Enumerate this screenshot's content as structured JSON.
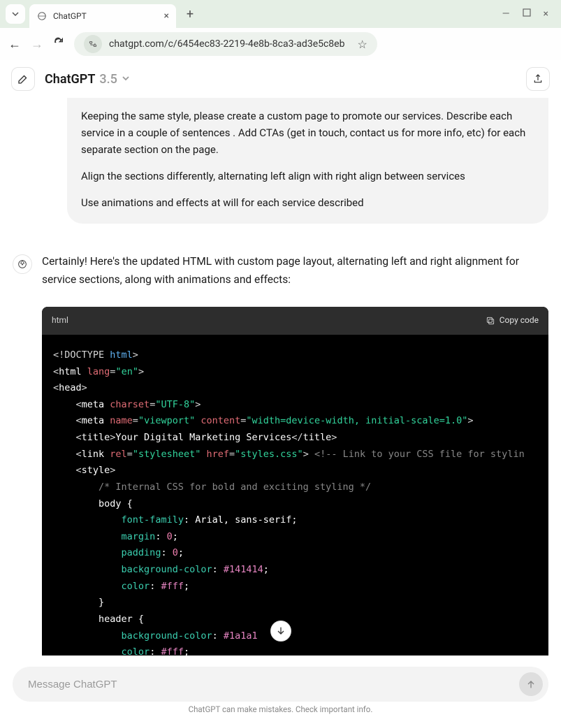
{
  "browser": {
    "tab_title": "ChatGPT",
    "url": "chatgpt.com/c/6454ec83-2219-4e8b-8ca3-ad3e5c8eb"
  },
  "header": {
    "brand": "ChatGPT",
    "version": "3.5"
  },
  "user_message": {
    "p1": "Keeping the same style, please create a custom page to promote our services. Describe each service in a couple of sentences . Add CTAs  (get in touch, contact us for more info, etc) for each separate section on the page.",
    "p2": "Align the sections differently, alternating left align with right align between services",
    "p3": "Use animations and effects at will for each service described"
  },
  "assistant_intro": "Certainly! Here's the updated HTML with custom page layout, alternating left and right alignment for service sections, along with animations and effects:",
  "code": {
    "lang_label": "html",
    "copy_label": "Copy code",
    "lines": {
      "doctype_open": "<!DOCTYPE ",
      "doctype_html": "html",
      "doctype_close": ">",
      "html_open": "<html ",
      "lang_attr": "lang",
      "lang_val": "\"en\"",
      "head": "<head>",
      "meta1_open": "    <meta ",
      "charset_attr": "charset",
      "charset_val": "\"UTF-8\"",
      "meta2_open": "    <meta ",
      "name_attr": "name",
      "name_val": "\"viewport\"",
      "content_attr": "content",
      "content_val": "\"width=device-width, initial-scale=1.0\"",
      "title_open": "    <title>",
      "title_text": "Your Digital Marketing Services",
      "title_close": "</title>",
      "link_open": "    <link ",
      "rel_attr": "rel",
      "rel_val": "\"stylesheet\"",
      "href_attr": "href",
      "href_val": "\"styles.css\"",
      "link_comment": " <!-- Link to your CSS file for stylin",
      "style_open": "    <style>",
      "css_comment": "        /* Internal CSS for bold and exciting styling */",
      "body_sel": "        body {",
      "ff_prop": "font-family",
      "ff_val": ": Arial, sans-serif;",
      "margin_prop": "margin",
      "zero1": "0",
      "padding_prop": "padding",
      "zero2": "0",
      "bgc_prop": "background-color",
      "bgc_val": "#141414",
      "color_prop": "color",
      "color_val": "#fff",
      "close_brace": "        }",
      "header_sel": "        header {",
      "bgc2_val": "#1a1a1",
      "color2_val": "#fff"
    }
  },
  "composer": {
    "placeholder": "Message ChatGPT"
  },
  "footer": "ChatGPT can make mistakes. Check important info."
}
